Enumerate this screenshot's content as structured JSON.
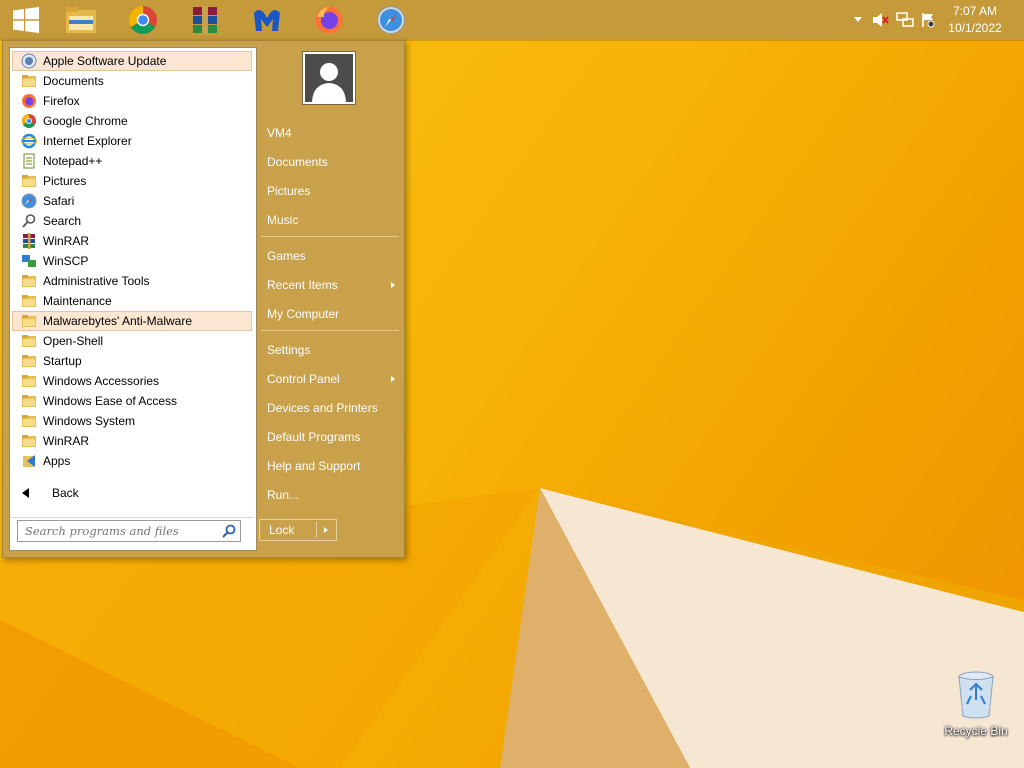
{
  "taskbar": {
    "pinned": [
      {
        "name": "start-button",
        "icon": "windows-logo-icon"
      },
      {
        "name": "file-explorer",
        "icon": "folder-icon"
      },
      {
        "name": "google-chrome",
        "icon": "chrome-icon"
      },
      {
        "name": "winrar",
        "icon": "winrar-icon"
      },
      {
        "name": "malwarebytes",
        "icon": "malwarebytes-icon"
      },
      {
        "name": "firefox",
        "icon": "firefox-icon"
      },
      {
        "name": "safari",
        "icon": "safari-icon"
      }
    ],
    "tray_icons": [
      "chevron-up-icon",
      "speaker-muted-icon",
      "network-icon",
      "action-center-flag-icon"
    ],
    "clock": {
      "time": "7:07 AM",
      "date": "10/1/2022"
    }
  },
  "start_menu": {
    "programs": [
      {
        "label": "Apple Software Update",
        "icon": "apple-update-icon",
        "highlight": true
      },
      {
        "label": "Documents",
        "icon": "folder-icon"
      },
      {
        "label": "Firefox",
        "icon": "firefox-icon"
      },
      {
        "label": "Google Chrome",
        "icon": "chrome-icon"
      },
      {
        "label": "Internet Explorer",
        "icon": "ie-icon"
      },
      {
        "label": "Notepad++",
        "icon": "notepad-icon"
      },
      {
        "label": "Pictures",
        "icon": "folder-icon"
      },
      {
        "label": "Safari",
        "icon": "safari-icon"
      },
      {
        "label": "Search",
        "icon": "search-icon"
      },
      {
        "label": "WinRAR",
        "icon": "winrar-icon"
      },
      {
        "label": "WinSCP",
        "icon": "winscp-icon"
      },
      {
        "label": "Administrative Tools",
        "icon": "folder-icon"
      },
      {
        "label": "Maintenance",
        "icon": "folder-icon"
      },
      {
        "label": "Malwarebytes' Anti-Malware",
        "icon": "folder-icon",
        "highlight": true
      },
      {
        "label": "Open-Shell",
        "icon": "folder-icon"
      },
      {
        "label": "Startup",
        "icon": "folder-icon"
      },
      {
        "label": "Windows Accessories",
        "icon": "folder-icon"
      },
      {
        "label": "Windows Ease of Access",
        "icon": "folder-icon"
      },
      {
        "label": "Windows System",
        "icon": "folder-icon"
      },
      {
        "label": "WinRAR",
        "icon": "folder-icon"
      },
      {
        "label": "Apps",
        "icon": "apps-icon"
      }
    ],
    "back_label": "Back",
    "search_placeholder": "Search programs and files",
    "right": [
      {
        "label": "VM4",
        "group": 1
      },
      {
        "label": "Documents",
        "group": 1
      },
      {
        "label": "Pictures",
        "group": 1
      },
      {
        "label": "Music",
        "group": 1
      },
      {
        "label": "Games",
        "group": 2
      },
      {
        "label": "Recent Items",
        "group": 2,
        "submenu": true
      },
      {
        "label": "My Computer",
        "group": 2
      },
      {
        "label": "Settings",
        "group": 3
      },
      {
        "label": "Control Panel",
        "group": 3,
        "submenu": true
      },
      {
        "label": "Devices and Printers",
        "group": 3
      },
      {
        "label": "Default Programs",
        "group": 3
      },
      {
        "label": "Help and Support",
        "group": 3
      },
      {
        "label": "Run...",
        "group": 3
      }
    ],
    "lock_label": "Lock"
  },
  "desktop": {
    "recycle_bin_label": "Recycle Bin"
  },
  "colors": {
    "taskbar": "#c49a3a",
    "menu_panel": "#c8a14a",
    "highlight": "#fbe6d2"
  }
}
